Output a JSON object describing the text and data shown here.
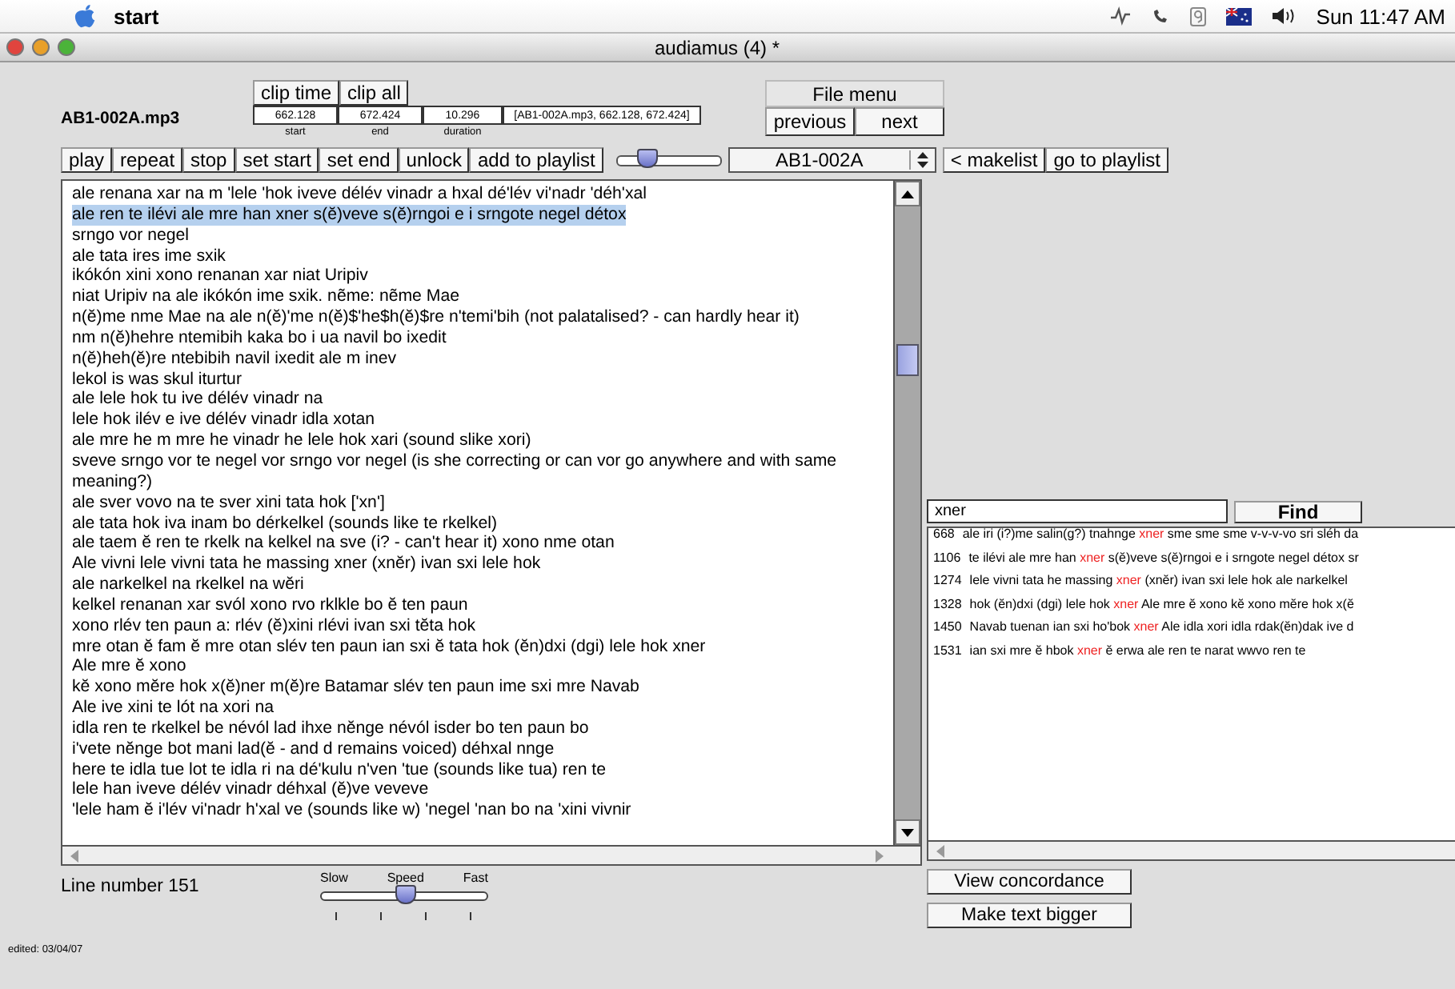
{
  "menubar": {
    "app": "start",
    "clock": "Sun 11:47 AM"
  },
  "window": {
    "title": "audiamus (4) *"
  },
  "file_name": "AB1-002A.mp3",
  "clip_buttons": [
    "clip time",
    "clip all"
  ],
  "clip_fields": [
    {
      "value": "662.128",
      "label": "start"
    },
    {
      "value": "672.424",
      "label": "end"
    },
    {
      "value": "10.296",
      "label": "duration"
    },
    {
      "value": "[AB1-002A.mp3, 662.128, 672.424]"
    }
  ],
  "file_menu": {
    "title": "File menu",
    "buttons": [
      "previous",
      "next"
    ]
  },
  "transport_buttons": [
    "play",
    "repeat",
    "stop",
    "set start",
    "set end",
    "unlock",
    "add to playlist"
  ],
  "volume": {
    "level": 0.28
  },
  "track_select": {
    "value": "AB1-002A"
  },
  "playlist_buttons": [
    "< makelist",
    "go to playlist"
  ],
  "transcript": {
    "lines": [
      {
        "text": "ale renana xar na m 'lele 'hok iveve délév vinadr a hxal dé'lév vi'nadr 'déh'xal",
        "selected": false
      },
      {
        "text": "ale ren te ilévi ale mre han xner s(ĕ)veve s(ĕ)rngoi e i srngote negel détox",
        "selected": true
      },
      {
        "text": "srngo vor negel",
        "selected": false
      },
      {
        "text": "ale tata ires ime sxik",
        "selected": false
      },
      {
        "text": "ikókón xini xono renanan xar niat Uripiv",
        "selected": false
      },
      {
        "text": "niat Uripiv na ale ikókón ime sxik. nẽme: nẽme Mae",
        "selected": false
      },
      {
        "text": "n(ĕ)me nme Mae na ale n(ĕ)'me n(ĕ)$'he$h(ĕ)$re n'temi'bih (not palatalised? - can hardly hear it)",
        "selected": false
      },
      {
        "text": "nm n(ĕ)hehre ntemibih kaka bo i ua navil bo ixedit",
        "selected": false
      },
      {
        "text": "n(ĕ)heh(ĕ)re ntebibih navil ixedit ale m inev",
        "selected": false
      },
      {
        "text": "lekol is was skul iturtur",
        "selected": false
      },
      {
        "text": "ale lele hok tu ive délév vinadr na",
        "selected": false
      },
      {
        "text": "lele hok ilév e ive délév vinadr idla xotan",
        "selected": false
      },
      {
        "text": "ale mre he m mre he vinadr he lele hok xari (sound slike xori)",
        "selected": false
      },
      {
        "text": "sveve srngo vor te negel vor srngo vor negel (is she correcting or can vor go anywhere and with same meaning?)",
        "selected": false
      },
      {
        "text": "ale sver vovo na te sver xini tata hok ['xn']",
        "selected": false
      },
      {
        "text": "ale tata hok iva inam bo dérkelkel (sounds like te rkelkel)",
        "selected": false
      },
      {
        "text": "ale taem ĕ ren te rkelk na kelkel na sve (i? - can't hear it) xono nme otan",
        "selected": false
      },
      {
        "text": "Ale vivni lele vivni tata he massing xner (xnĕr) ivan sxi lele hok",
        "selected": false
      },
      {
        "text": "ale narkelkel na rkelkel na wĕri",
        "selected": false
      },
      {
        "text": "kelkel renanan xar svól xono rvo rklkle bo ĕ ten paun",
        "selected": false
      },
      {
        "text": "xono rlév ten paun a: rlév (ĕ)xini rlévi ivan sxi tĕta hok",
        "selected": false
      },
      {
        "text": "mre otan ĕ fam ĕ mre otan slév ten paun ian sxi ĕ tata hok (ĕn)dxi (dgi) lele hok xner",
        "selected": false
      },
      {
        "text": "Ale mre ĕ xono",
        "selected": false
      },
      {
        "text": "kĕ xono mĕre hok x(ĕ)ner m(ĕ)re Batamar slév ten paun ime sxi mre Navab",
        "selected": false
      },
      {
        "text": "Ale ive xini te lót na xori na",
        "selected": false
      },
      {
        "text": "idla ren te rkelkel be névól lad ihxe nĕnge névól isder bo ten paun bo",
        "selected": false
      },
      {
        "text": "i'vete nĕnge bot mani lad(ĕ - and d remains voiced) déhxal nnge",
        "selected": false
      },
      {
        "text": "here te idla tue lot te idla ri na dé'kulu n'ven 'tue (sounds like tua) ren te",
        "selected": false
      },
      {
        "text": "lele han iveve délév vinadr déhxal (ĕ)ve veveve",
        "selected": false
      },
      {
        "text": "'lele ham ĕ i'lév vi'nadr h'xal ve (sounds like w) 'negel 'nan bo na 'xini vivnir",
        "selected": false
      }
    ]
  },
  "line_number": "Line number 151",
  "speed": {
    "labels": [
      "Slow",
      "Speed",
      "Fast"
    ],
    "level": 0.5
  },
  "search": {
    "value": "xner",
    "button": "Find"
  },
  "concordance": [
    {
      "number": "668",
      "before": "ale iri (i?)me salin(g?) tnahnge ",
      "match": "xner",
      "after": " sme sme sme v-v-v-vo sri sléh da"
    },
    {
      "number": "1106",
      "before": "te ilévi ale mre han ",
      "match": "xner",
      "after": " s(ĕ)veve s(ĕ)rngoi e i srngote negel détox sr"
    },
    {
      "number": "1274",
      "before": "lele vivni tata he massing ",
      "match": "xner",
      "after": " (xnĕr) ivan sxi lele hok ale narkelkel"
    },
    {
      "number": "1328",
      "before": "hok (ĕn)dxi (dgi) lele hok ",
      "match": "xner",
      "after": " Ale mre ĕ xono  kĕ xono mĕre hok x(ĕ"
    },
    {
      "number": "1450",
      "before": "Navab tuenan ian sxi ho'bok ",
      "match": "xner",
      "after": " Ale idla xori idla rdak(ĕn)dak ive d"
    },
    {
      "number": "1531",
      "before": "ian sxi mre ĕ hbok ",
      "match": "xner",
      "after": " ĕ erwa ale ren te narat wwvo ren te"
    }
  ],
  "side_buttons": [
    "View concordance",
    "Make text bigger"
  ],
  "status": "edited: 03/04/07"
}
